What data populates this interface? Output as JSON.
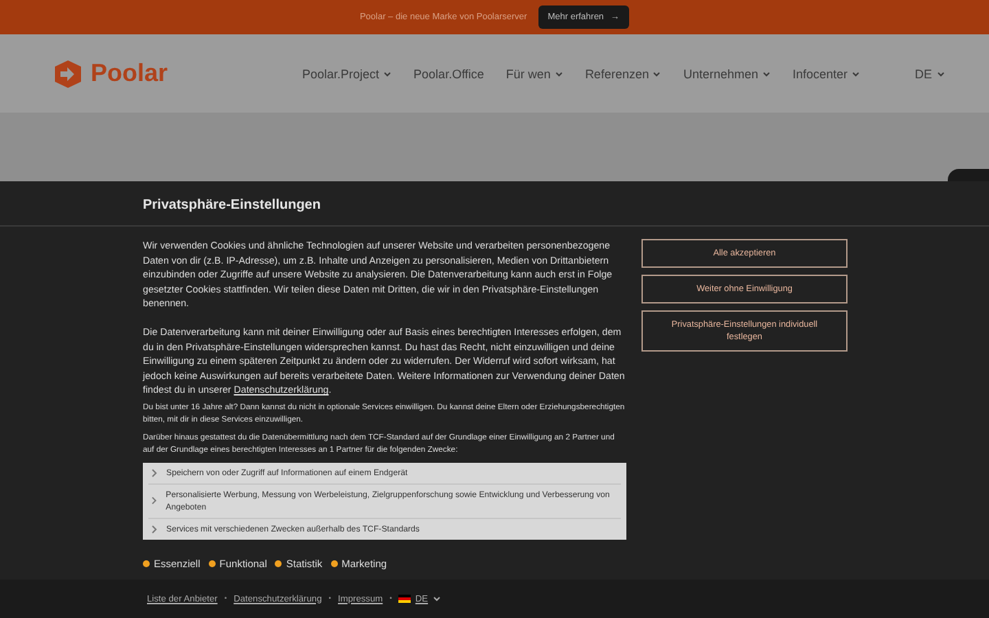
{
  "banner": {
    "text": "Poolar – die neue Marke von Poolarserver",
    "button": "Mehr erfahren",
    "button_icon": "→"
  },
  "header": {
    "logo": "Poolar",
    "nav": [
      {
        "label": "Poolar.Project",
        "dropdown": true
      },
      {
        "label": "Poolar.Office",
        "dropdown": false
      },
      {
        "label": "Für wen",
        "dropdown": true
      },
      {
        "label": "Referenzen",
        "dropdown": true
      },
      {
        "label": "Unternehmen",
        "dropdown": true
      },
      {
        "label": "Infocenter",
        "dropdown": true
      }
    ],
    "language": "DE"
  },
  "consent": {
    "title": "Privatsphäre-Einstellungen",
    "paragraphs": [
      {
        "text": "Wir verwenden Cookies und ähnliche Technologien auf unserer Website und verarbeiten personenbezogene Daten von dir (z.B. IP-Adresse), um z.B. Inhalte und Anzeigen zu personalisieren, Medien von Drittanbietern einzubinden oder Zugriffe auf unsere Website zu analysieren. Die Datenverarbeitung kann auch erst in Folge gesetzter Cookies stattfinden. Wir teilen diese Daten mit Dritten, die wir in den Privatsphäre-Einstellungen benennen."
      },
      {
        "text": "Die Datenverarbeitung kann mit deiner Einwilligung oder auf Basis eines berechtigten Interesses erfolgen, dem du in den Privatsphäre-Einstellungen widersprechen kannst. Du hast das Recht, nicht einzuwilligen und deine Einwilligung zu einem späteren Zeitpunkt zu ändern oder zu widerrufen. Der Widerruf wird sofort wirksam, hat jedoch keine Auswirkungen auf bereits verarbeitete Daten. Weitere Informationen zur Verwendung deiner Daten findest du in unserer ",
        "link": "Datenschutzerklärung",
        "after": "."
      }
    ],
    "notes": [
      "Du bist unter 16 Jahre alt? Dann kannst du nicht in optionale Services einwilligen. Du kannst deine Eltern oder Erziehungsberechtigten bitten, mit dir in diese Services einzuwilligen.",
      "Darüber hinaus gestattest du die Datenübermittlung nach dem TCF-Standard auf der Grundlage einer Einwilligung an 2 Partner und auf der Grundlage eines berechtigten Interesses an 1 Partner für die folgenden Zwecke:"
    ],
    "purposes": [
      {
        "label": "Speichern von oder Zugriff auf Informationen auf einem Endgerät"
      },
      {
        "label": "Personalisierte Werbung, Messung von Werbeleistung, Zielgruppenforschung sowie Entwicklung und Verbesserung von Angeboten"
      },
      {
        "label": "Services mit verschiedenen Zwecken außerhalb des TCF-Standards"
      }
    ],
    "categories": [
      "Essenziell",
      "Funktional",
      "Statistik",
      "Marketing"
    ],
    "buttons": [
      "Alle akzeptieren",
      "Weiter ohne Einwilligung",
      "Privatsphäre-Einstellungen individuell festlegen"
    ]
  },
  "footer": {
    "links": [
      "Liste der Anbieter",
      "Datenschutzerklärung",
      "Impressum"
    ],
    "separator": "•",
    "language": "DE"
  }
}
